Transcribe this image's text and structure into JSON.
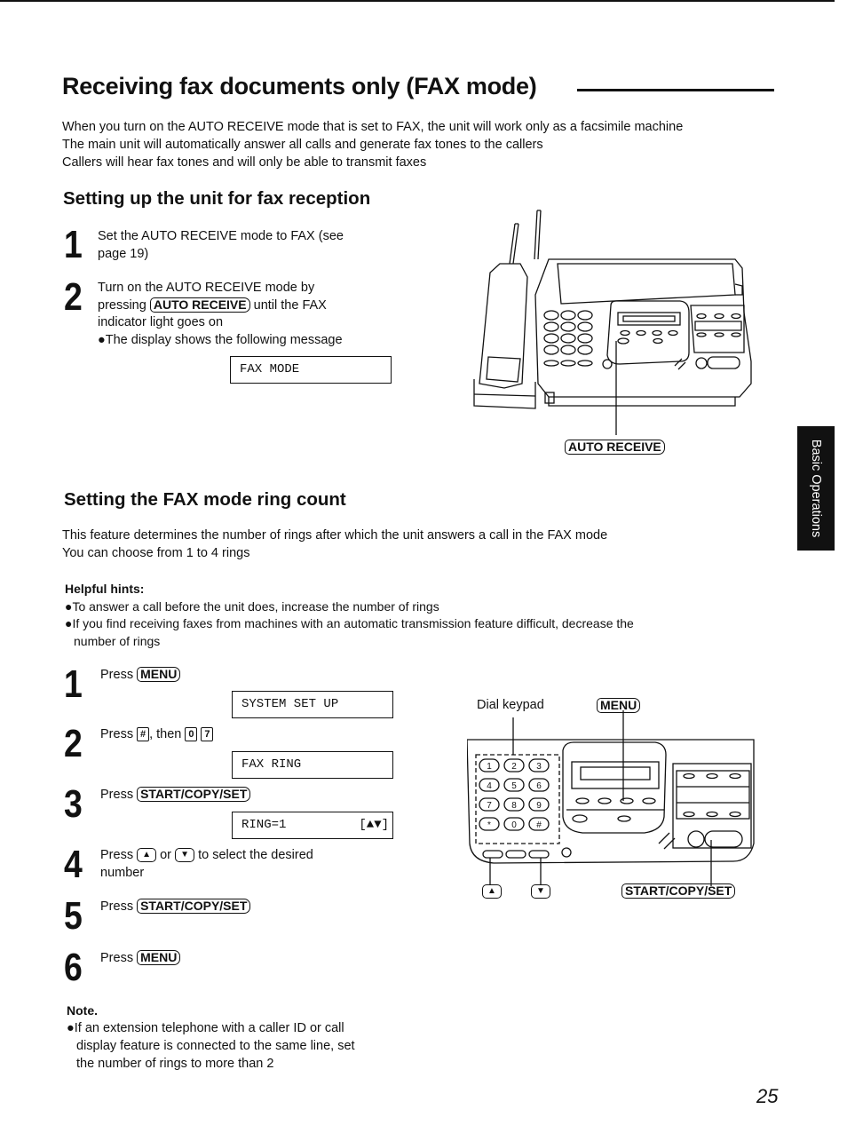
{
  "page": {
    "title": "Receiving fax documents only (FAX mode)",
    "intro": [
      "When you turn on the AUTO RECEIVE mode that is set to FAX, the unit will work only as a facsimile machine",
      "The main unit will automatically answer all calls and generate fax tones to the callers",
      "Callers will hear fax tones and will only be able to transmit faxes"
    ],
    "side_tab": "Basic Operations",
    "page_number": "25"
  },
  "section1": {
    "heading": "Setting up the unit for fax reception",
    "steps": [
      {
        "num": "1",
        "line1": "Set the AUTO RECEIVE mode to FAX (see",
        "line2": "page 19)"
      },
      {
        "num": "2",
        "line1": "Turn on the AUTO RECEIVE mode by",
        "pre_key": "pressing ",
        "key": "AUTO RECEIVE",
        "post_key": " until the FAX",
        "line3": "indicator light goes on",
        "bullet": "●The display shows the following message",
        "display": "FAX MODE"
      }
    ],
    "figure_label": "AUTO RECEIVE"
  },
  "section2": {
    "heading": "Setting the FAX mode ring count",
    "intro": [
      "This feature determines the number of rings after which the unit answers a call in the FAX mode",
      "You can choose from 1 to 4 rings"
    ],
    "hints_title": "Helpful hints:",
    "hints": [
      "●To answer a call before the unit does, increase the number of rings",
      "●If you find receiving faxes from machines with an automatic transmission feature difficult, decrease the",
      "number of rings"
    ],
    "steps": [
      {
        "num": "1",
        "text": "Press ",
        "key": "MENU",
        "display": "SYSTEM SET UP"
      },
      {
        "num": "2",
        "text": "Press ",
        "key1": "#",
        "mid": ", then ",
        "key2": "0",
        "key3": "7",
        "display": "FAX RING"
      },
      {
        "num": "3",
        "text": "Press ",
        "key": "START/COPY/SET",
        "display": "RING=1",
        "display_right": "[▲▼]"
      },
      {
        "num": "4",
        "text": "Press ",
        "key_up": "▲",
        "mid": " or ",
        "key_down": "▼",
        "post": " to select the desired",
        "line2": "number"
      },
      {
        "num": "5",
        "text": "Press ",
        "key": "START/COPY/SET"
      },
      {
        "num": "6",
        "text": "Press ",
        "key": "MENU"
      }
    ],
    "note_title": "Note.",
    "note": [
      "●If an extension telephone with a caller ID or call",
      "display feature is connected to the same line, set",
      "the number of rings to more than 2"
    ],
    "figure": {
      "dial_keypad_label": "Dial keypad",
      "menu_label": "MENU",
      "start_label": "START/COPY/SET",
      "up_label": "▲",
      "down_label": "▼",
      "keypad_keys": [
        "1",
        "2",
        "3",
        "4",
        "5",
        "6",
        "7",
        "8",
        "9",
        "*",
        "0",
        "#"
      ]
    }
  }
}
